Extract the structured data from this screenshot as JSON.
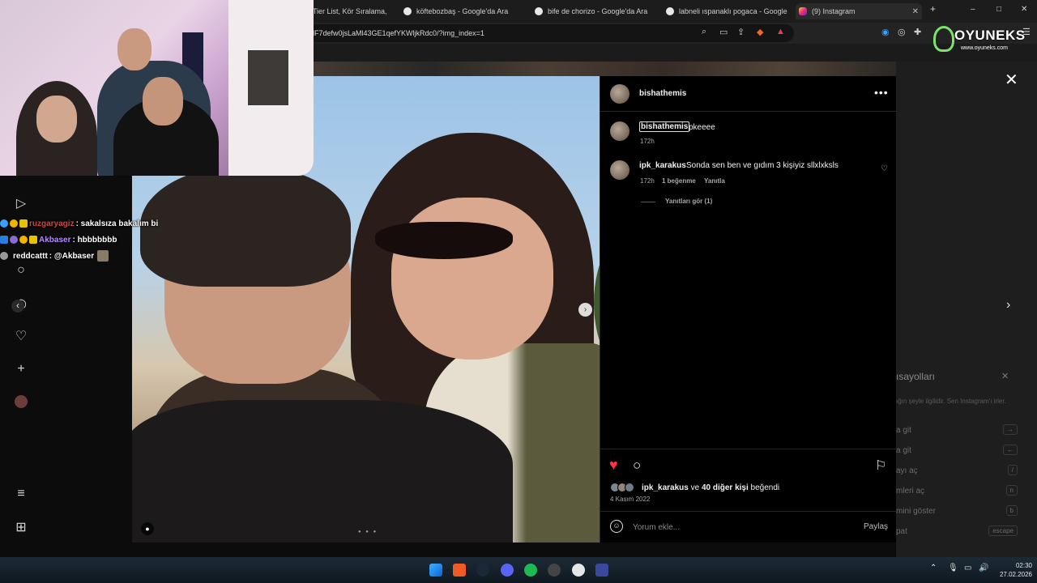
{
  "browser": {
    "tabs": [
      {
        "label": "ira - Tier List, Kör Sıralama, O",
        "active": false
      },
      {
        "label": "köftebozbaş - Google'da Ara",
        "active": false
      },
      {
        "label": "bife de chorizo - Google'da Ara",
        "active": false
      },
      {
        "label": "labneli ıspanaklı pogaca - Google'da",
        "active": false
      },
      {
        "label": "(9) Instagram",
        "active": true
      }
    ],
    "new_tab": "+",
    "url": "lF7defw0jsLaMl43GE1qefYKWljkRdc0/?img_index=1",
    "window_controls": [
      "–",
      "□",
      "✕"
    ]
  },
  "post": {
    "author": "bishathemis",
    "caption_user": "bishathemis",
    "caption_text": "pkeeee",
    "caption_age": "172h",
    "comments": [
      {
        "user": "ipk_karakus",
        "text": "Sonda sen ben ve gıdım 3 kişiyiz sllxlxksls",
        "age": "172h",
        "likes": "1 beğenme",
        "reply": "Yanıtla"
      }
    ],
    "view_replies": "Yanıtları gör (1)",
    "likes_user": "ipk_karakus",
    "likes_and": "ve",
    "likes_others": "40 diğer kişi",
    "likes_suffix": "beğendi",
    "date": "4 Kasım 2022",
    "comment_placeholder": "Yorum ekle...",
    "post_label": "Paylaş",
    "liked": true,
    "heart_color": "#ff3040"
  },
  "shortcuts_panel": {
    "title": "ısayolları",
    "close": "✕",
    "desc": "ığın şeyle ilgilidir. Sen Instagram'ı irler.",
    "rows": [
      {
        "label": "a git",
        "key": "→"
      },
      {
        "label": "a git",
        "key": "←"
      },
      {
        "label": "ayı aç",
        "key": "/"
      },
      {
        "label": "mleri aç",
        "key": "n"
      },
      {
        "label": "mini göster",
        "key": "b"
      },
      {
        "label": "pat",
        "key": "escape"
      }
    ]
  },
  "chat": [
    {
      "user": "ruzgaryagiz",
      "message": ": sakalsıza bakalım bi",
      "color": "#c24a4a"
    },
    {
      "user": "Akbaser",
      "message": ": hbbbbbbb",
      "color": "#b58cff"
    },
    {
      "user": "reddcattt",
      "message": ": @Akbaser",
      "color": "#ffffff"
    }
  ],
  "watermark": {
    "title": "OYUNEKS",
    "subtitle": "www.oyuneks.com"
  },
  "taskbar": {
    "time": "02:30",
    "date": "27.02.2026"
  },
  "icons": {
    "sidebar": [
      "reels-icon",
      "search-icon",
      "explore-icon",
      "heart-icon",
      "create-icon",
      "profile-icon",
      "menu-icon",
      "more-icon"
    ],
    "actions": [
      "heart-icon",
      "comment-icon",
      "bookmark-icon"
    ]
  }
}
